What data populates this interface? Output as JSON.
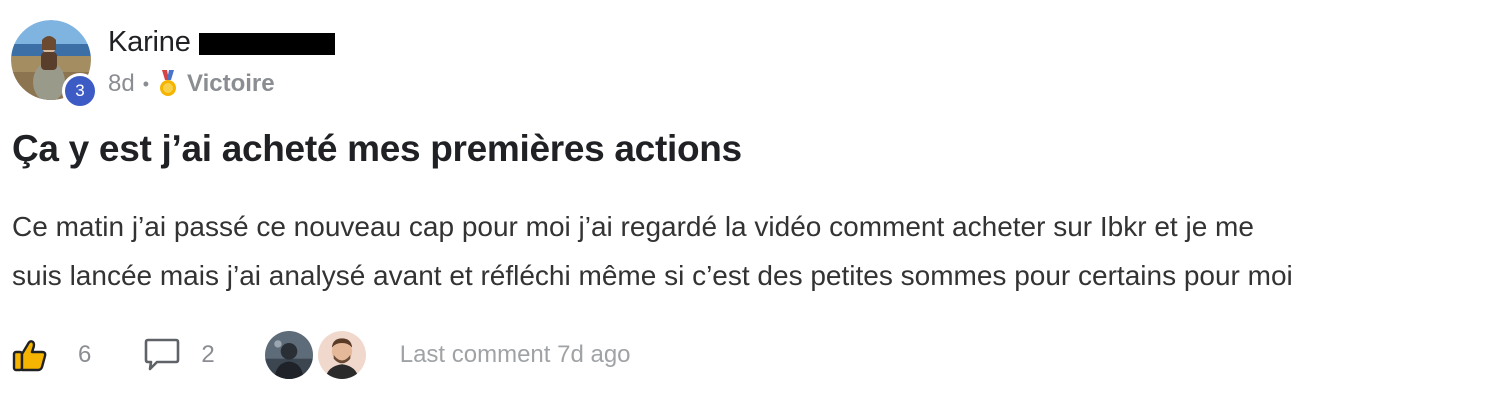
{
  "author": {
    "name": "Karine",
    "name_redacted": true,
    "level": "3",
    "avatar_icon": "profile-photo-seaside"
  },
  "meta": {
    "time_ago": "8d",
    "separator": "•",
    "category_icon": "gold-medal-icon",
    "category": "Victoire"
  },
  "post": {
    "title": "Ça y est j’ai acheté mes premières actions",
    "body_line1": "Ce matin j’ai passé ce nouveau cap pour moi j’ai regardé la vidéo comment acheter sur Ibkr et je me",
    "body_line2": "suis lancée mais j’ai analysé avant et réfléchi même si c’est des petites sommes pour certains pour moi"
  },
  "footer": {
    "like_icon": "thumbs-up-icon",
    "like_count": "6",
    "comment_icon": "comment-bubble-icon",
    "comment_count": "2",
    "commenters": [
      "commenter-avatar-1",
      "commenter-avatar-2"
    ],
    "last_comment": "Last comment 7d ago"
  },
  "colors": {
    "text_primary": "#202124",
    "text_muted": "#8a8d91",
    "badge_blue": "#3d5bc4",
    "medal_gold": "#f4b400",
    "medal_ribbon": "#d64545"
  }
}
